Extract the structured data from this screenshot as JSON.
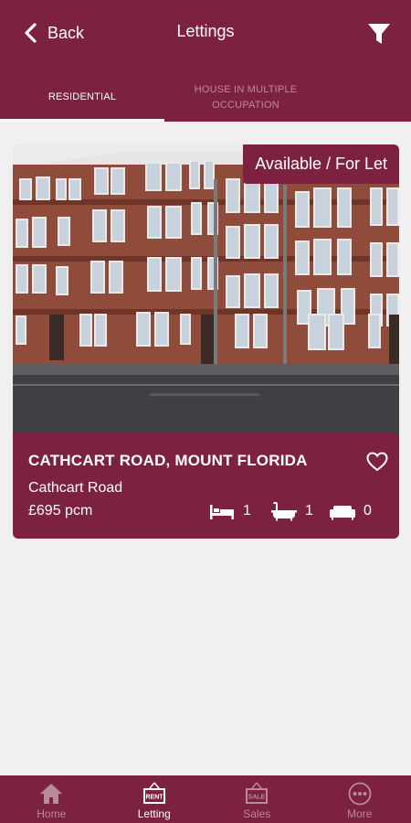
{
  "header": {
    "back_label": "Back",
    "title": "Lettings",
    "tabs": [
      {
        "label": "RESIDENTIAL",
        "active": true
      },
      {
        "label": "HOUSE IN MULTIPLE OCCUPATION",
        "active": false
      }
    ]
  },
  "listing": {
    "status_badge": "Available / For Let",
    "title": "CATHCART ROAD, MOUNT FLORIDA",
    "subtitle": "Cathcart Road",
    "price": "£695 pcm",
    "bedrooms": "1",
    "bathrooms": "1",
    "receptions": "0",
    "favorite_icon": "heart-outline-icon"
  },
  "bottom_nav": {
    "items": [
      {
        "label": "Home",
        "icon": "home-icon",
        "active": false
      },
      {
        "label": "Letting",
        "icon": "rent-sign-icon",
        "active": true
      },
      {
        "label": "Sales",
        "icon": "sale-sign-icon",
        "active": false
      },
      {
        "label": "More",
        "icon": "more-dots-icon",
        "active": false
      }
    ]
  },
  "colors": {
    "brand": "#7d2141",
    "background": "#f0f0f0",
    "inactive_text": "#b98a99"
  }
}
